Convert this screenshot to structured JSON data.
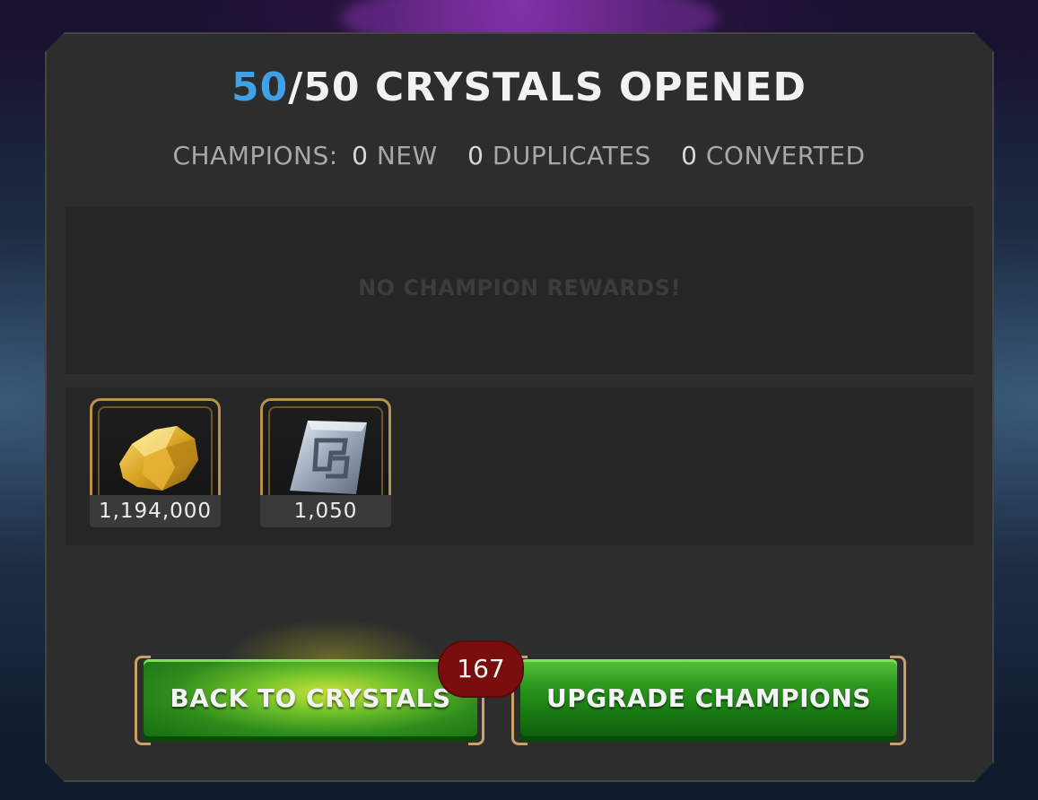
{
  "header": {
    "opened_count": "50",
    "total_count": "/50 CRYSTALS OPENED"
  },
  "summary": {
    "label": "CHAMPIONS:",
    "new_count": "0",
    "new_label": "NEW",
    "dup_count": "0",
    "dup_label": "DUPLICATES",
    "conv_count": "0",
    "conv_label": "CONVERTED"
  },
  "champion_rewards": {
    "empty_text": "NO CHAMPION REWARDS!"
  },
  "items": [
    {
      "icon": "gold-icon",
      "amount": "1,194,000"
    },
    {
      "icon": "rune-icon",
      "amount": "1,050"
    }
  ],
  "buttons": {
    "back_label": "BACK TO CRYSTALS",
    "badge_count": "167",
    "upgrade_label": "UPGRADE CHAMPIONS"
  },
  "colors": {
    "accent_blue": "#3fa2e8",
    "button_green": "#2d9a1f",
    "badge_red": "#7a0e0e",
    "frame_gold": "#b8924a"
  }
}
